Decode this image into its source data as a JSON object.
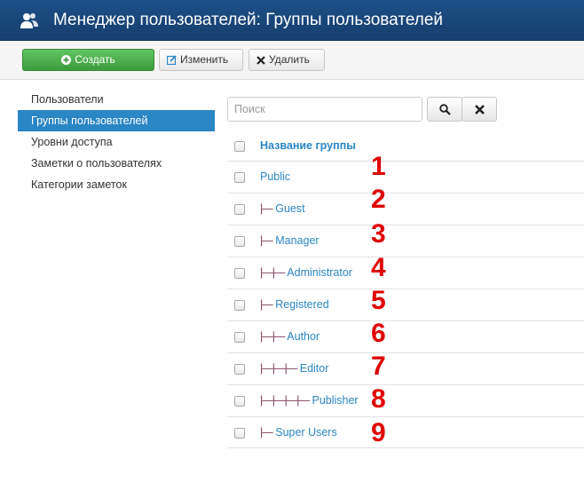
{
  "header": {
    "title": "Менеджер пользователей: Группы пользователей",
    "icon": "users-icon"
  },
  "toolbar": {
    "create_label": "Создать",
    "edit_label": "Изменить",
    "delete_label": "Удалить"
  },
  "sidebar": {
    "items": [
      {
        "label": "Пользователи"
      },
      {
        "label": "Группы пользователей"
      },
      {
        "label": "Уровни доступа"
      },
      {
        "label": "Заметки о пользователях"
      },
      {
        "label": "Категории заметок"
      }
    ],
    "active_item": "Группы пользователей"
  },
  "search": {
    "placeholder": "Поиск"
  },
  "table": {
    "header": "Название группы",
    "rows": [
      {
        "prefix": "",
        "name": "Public"
      },
      {
        "prefix": "|—",
        "name": "Guest"
      },
      {
        "prefix": "|—",
        "name": "Manager"
      },
      {
        "prefix": "|—|—",
        "name": "Administrator"
      },
      {
        "prefix": "|—",
        "name": "Registered"
      },
      {
        "prefix": "|—|—",
        "name": "Author"
      },
      {
        "prefix": "|—|—|—",
        "name": "Editor"
      },
      {
        "prefix": "|—|—|—|—",
        "name": "Publisher"
      },
      {
        "prefix": "|—",
        "name": "Super Users"
      }
    ]
  },
  "annotations": [
    "1",
    "2",
    "3",
    "4",
    "5",
    "6",
    "7",
    "8",
    "9"
  ],
  "colors": {
    "header_bg": "#1d4f86",
    "accent": "#2a86c5",
    "create_button": "#4cae4c",
    "annotation": "#e00000"
  }
}
